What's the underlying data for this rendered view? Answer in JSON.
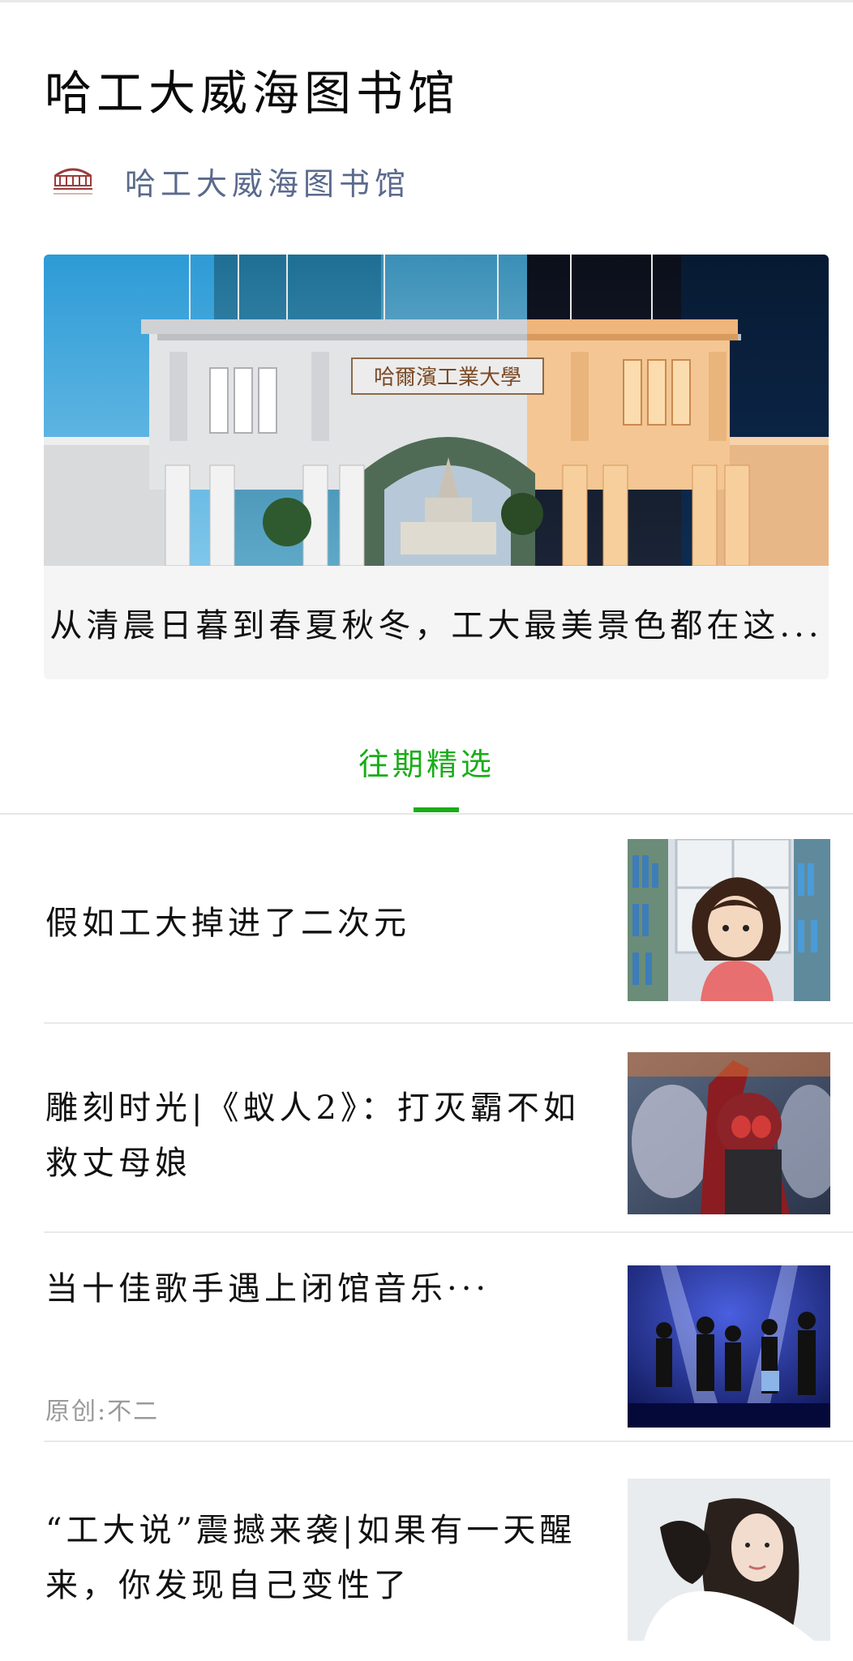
{
  "page": {
    "title": "哈工大威海图书馆"
  },
  "account": {
    "avatar_icon": "library-logo-icon",
    "name": "哈工大威海图书馆"
  },
  "featured": {
    "caption": "从清晨日暮到春夏秋冬，工大最美景色都在这...",
    "image": "campus-gate-image",
    "gate_sign": "哈爾濱工業大學"
  },
  "tabs": {
    "active_label": "往期精选",
    "accent_color": "#1aad19"
  },
  "articles": [
    {
      "title": "假如工大掉进了二次元",
      "meta": "",
      "thumb": "anime-girl-library-thumbnail"
    },
    {
      "title": "雕刻时光|《蚁人2》：打灭霸不如救丈母娘",
      "meta": "",
      "thumb": "antman-movie-thumbnail"
    },
    {
      "title": "当十佳歌手遇上闭馆音乐···",
      "meta": "原创:不二",
      "thumb": "concert-stage-thumbnail"
    },
    {
      "title": "“工大说”震撼来袭|如果有一天醒来，你发现自己变性了",
      "meta": "",
      "thumb": "actress-portrait-thumbnail"
    }
  ]
}
